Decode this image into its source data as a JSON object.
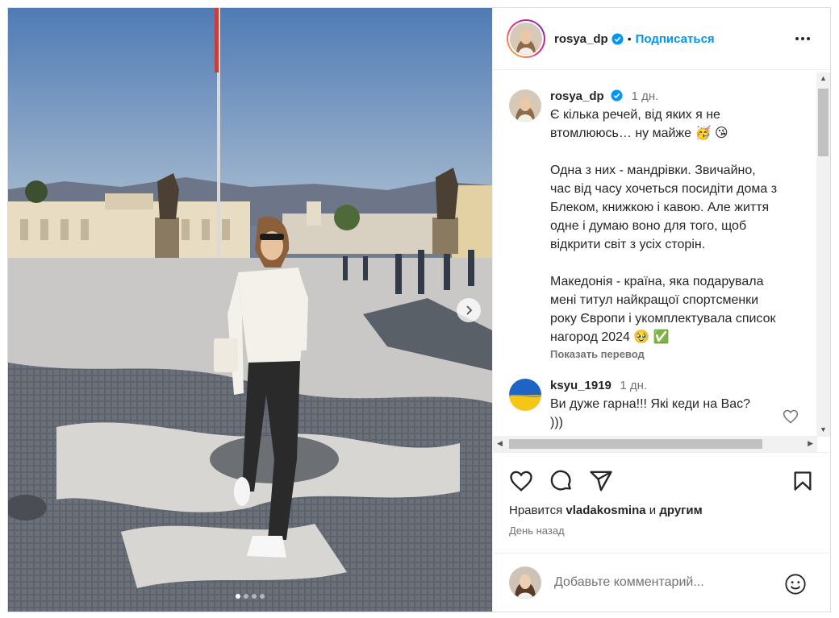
{
  "post": {
    "author": "rosya_dp",
    "follow_label": "Подписаться",
    "separator": "•",
    "carousel": {
      "slide_count": 4,
      "active_index": 0
    }
  },
  "caption": {
    "username": "rosya_dp",
    "time": "1 дн.",
    "text": "Є кілька речей, від яких я не\nвтомлююсь… ну майже 🥳 😘\n\nОдна з них - мандрівки. Звичайно,\nчас від часу хочеться посидіти дома з\nБлеком, книжкою і кавою. Але життя\nодне і думаю воно для того, щоб\nвідкрити світ з усіх сторін.\n\nМакедонія - країна, яка подарувала\nмені титул найкращої спортсменки\nроку Європи і укомплектувала список\nнагород 2024 🥹 ✅",
    "translate_label": "Показать перевод"
  },
  "comments": [
    {
      "username": "ksyu_1919",
      "time": "1 дн.",
      "text": "Ви дуже гарна!!! Які кеди на Вас?\n)))"
    }
  ],
  "likes": {
    "prefix": "Нравится",
    "user": "vladakosmina",
    "middle": "и",
    "suffix": "другим"
  },
  "date_label": "День назад",
  "comment_input": {
    "placeholder": "Добавьте комментарий..."
  },
  "colors": {
    "accent": "#0095f6",
    "secondary_text": "#737373",
    "text": "#262626"
  },
  "icons": [
    "verified-badge-icon",
    "more-options-icon",
    "heart-icon",
    "comment-icon",
    "share-icon",
    "bookmark-icon",
    "emoji-icon",
    "chevron-right-icon"
  ]
}
